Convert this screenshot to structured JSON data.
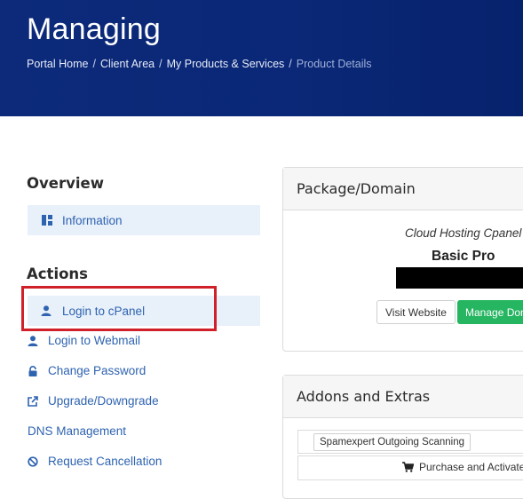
{
  "header": {
    "title": "Managing",
    "breadcrumb": [
      "Portal Home",
      "Client Area",
      "My Products & Services",
      "Product Details"
    ]
  },
  "sidebar": {
    "overview_title": "Overview",
    "information_label": "Information",
    "actions_title": "Actions",
    "actions": [
      {
        "label": "Login to cPanel",
        "icon": "user-icon"
      },
      {
        "label": "Login to Webmail",
        "icon": "user-icon"
      },
      {
        "label": "Change Password",
        "icon": "lock-icon"
      },
      {
        "label": "Upgrade/Downgrade",
        "icon": "external-link-icon"
      },
      {
        "label": "DNS Management",
        "icon": ""
      },
      {
        "label": "Request Cancellation",
        "icon": "ban-icon"
      }
    ]
  },
  "package_panel": {
    "title": "Package/Domain",
    "product_group": "Cloud Hosting Cpanel",
    "product_name": "Basic Pro",
    "visit_label": "Visit Website",
    "manage_label": "Manage Domain"
  },
  "addons_panel": {
    "title": "Addons and Extras",
    "addon_name": "Spamexpert Outgoing Scanning",
    "purchase_label": "Purchase and Activate"
  },
  "colors": {
    "header_bg": "#0a2877",
    "link": "#2e63b0",
    "active_bg": "#e8f0fa",
    "highlight": "#d0202a",
    "success": "#26b561"
  }
}
